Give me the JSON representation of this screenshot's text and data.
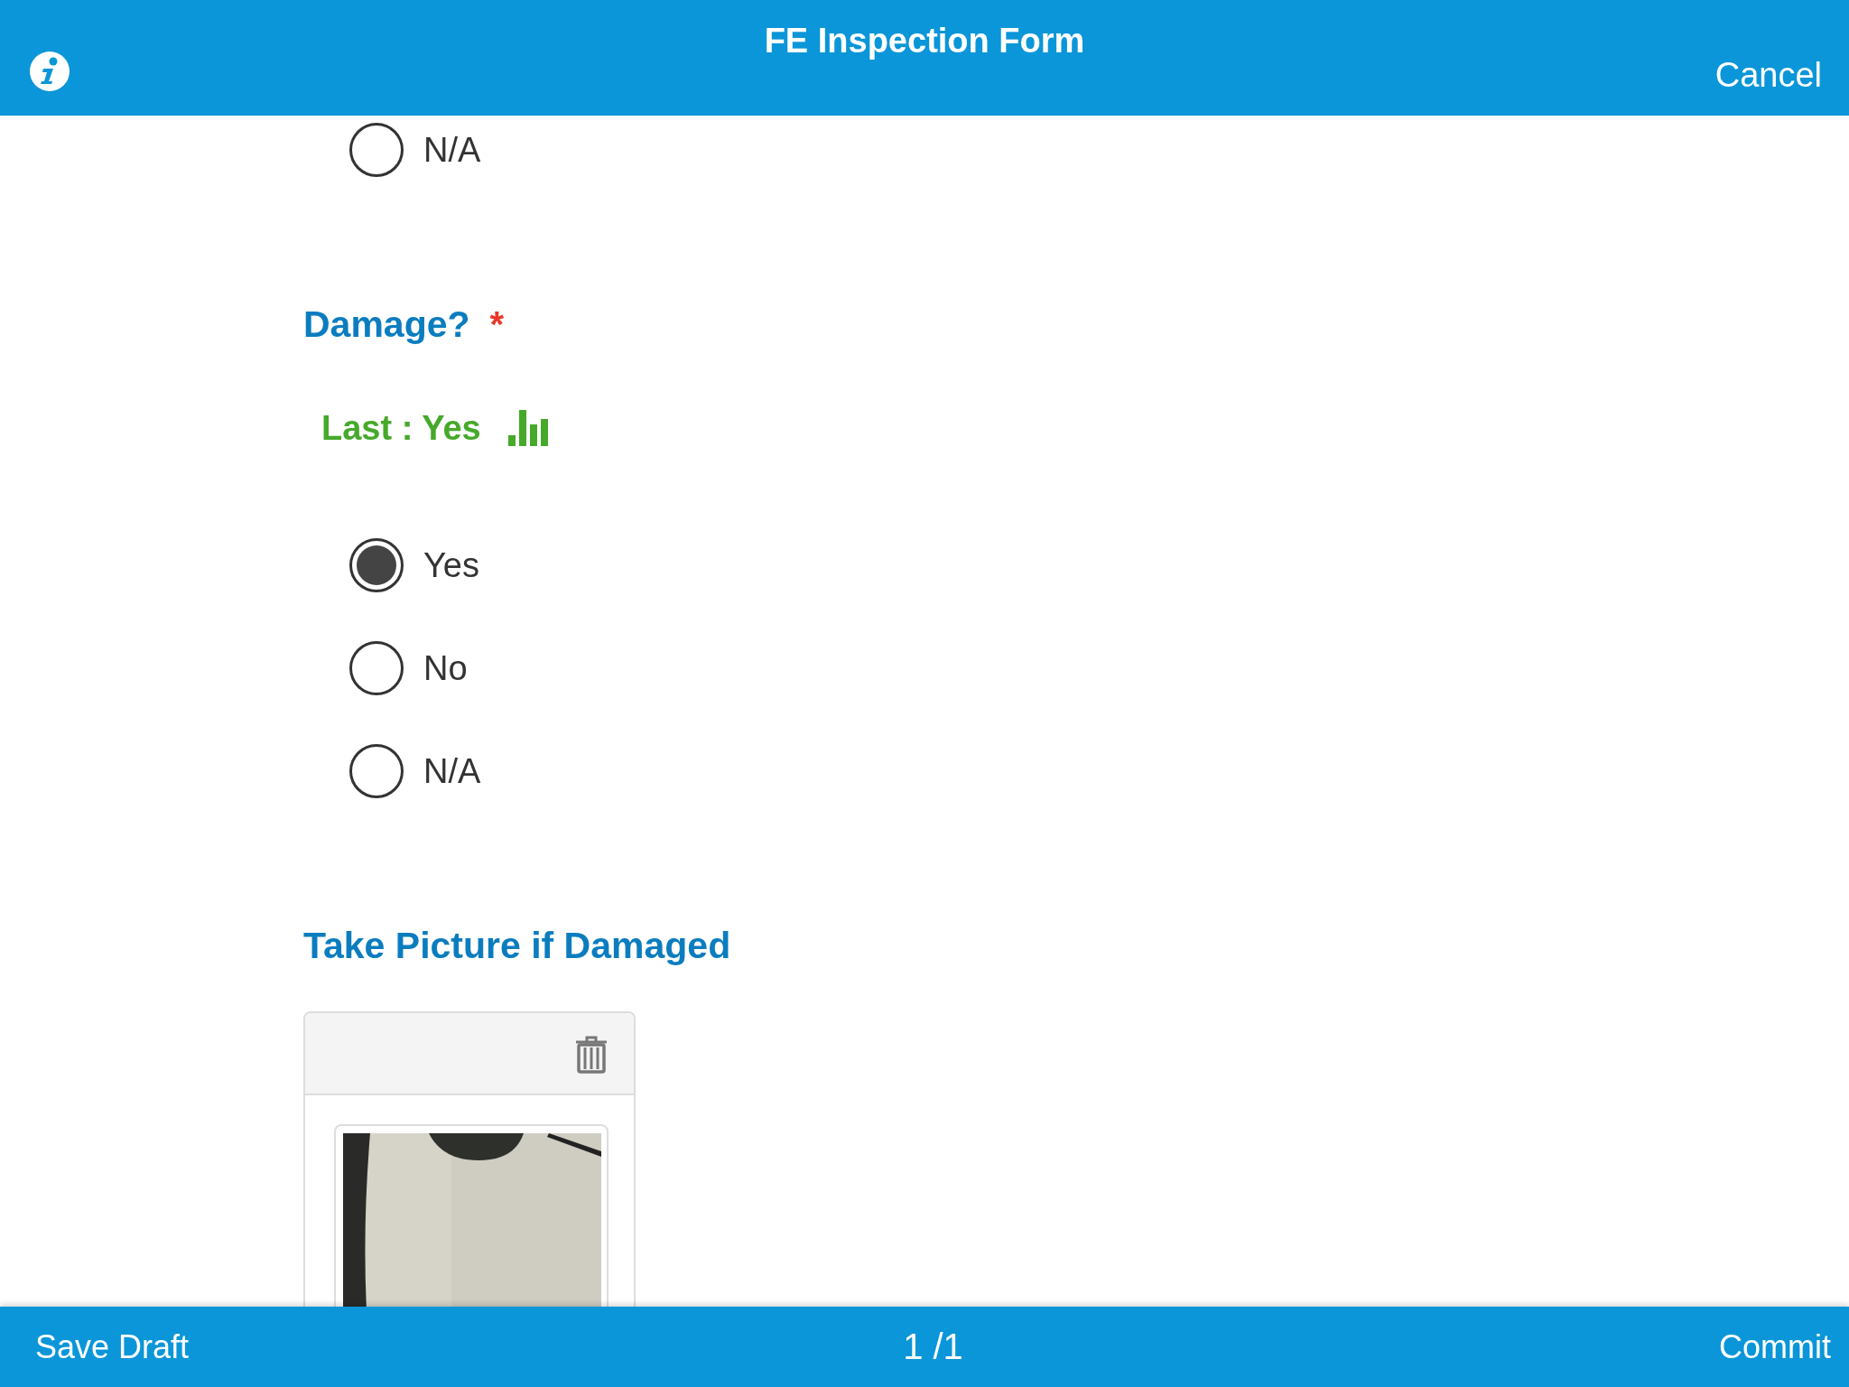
{
  "header": {
    "title": "FE Inspection Form",
    "cancel": "Cancel"
  },
  "questions": [
    {
      "kind": "choice",
      "options": [
        {
          "label": "N/A",
          "selected": false
        }
      ]
    },
    {
      "kind": "choice",
      "label": "Damage?",
      "required_mark": "*",
      "last": "Last : Yes",
      "options": [
        {
          "label": "Yes",
          "selected": true
        },
        {
          "label": "No",
          "selected": false
        },
        {
          "label": "N/A",
          "selected": false
        }
      ]
    },
    {
      "label": "Take Picture if Damaged"
    }
  ],
  "footer": {
    "save": "Save Draft",
    "page": "1 /1",
    "commit": "Commit"
  }
}
